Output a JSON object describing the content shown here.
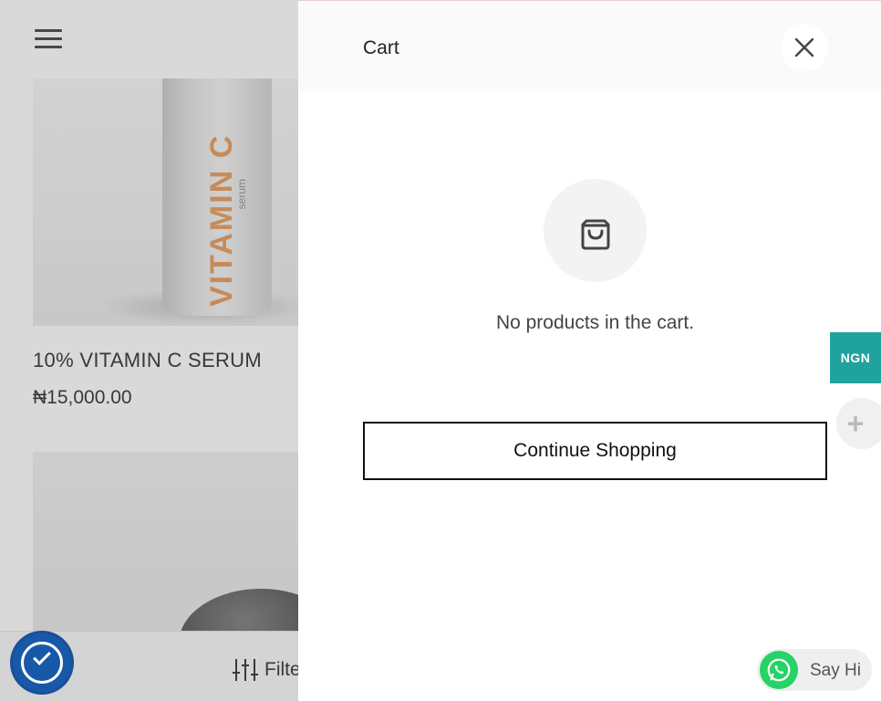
{
  "background_page": {
    "product_1": {
      "image_label": "VITAMIN C",
      "image_sublabel": "serum",
      "title": "10% VITAMIN C SERUM",
      "price": "₦15,000.00"
    },
    "filter_label": "Filte"
  },
  "cart": {
    "title": "Cart",
    "empty_message": "No products in the cart.",
    "continue_button": "Continue Shopping"
  },
  "widgets": {
    "currency": "NGN",
    "plus_symbol": "+",
    "chat_label": "Say Hi"
  },
  "colors": {
    "currency_badge": "#20a39e",
    "whatsapp": "#25d366",
    "accessibility": "#1858a8"
  },
  "icons": {
    "menu": "hamburger-menu-icon",
    "close": "close-icon",
    "bag": "shopping-bag-icon",
    "filter": "filter-sliders-icon",
    "accessibility": "accessibility-icon",
    "whatsapp": "whatsapp-icon"
  }
}
